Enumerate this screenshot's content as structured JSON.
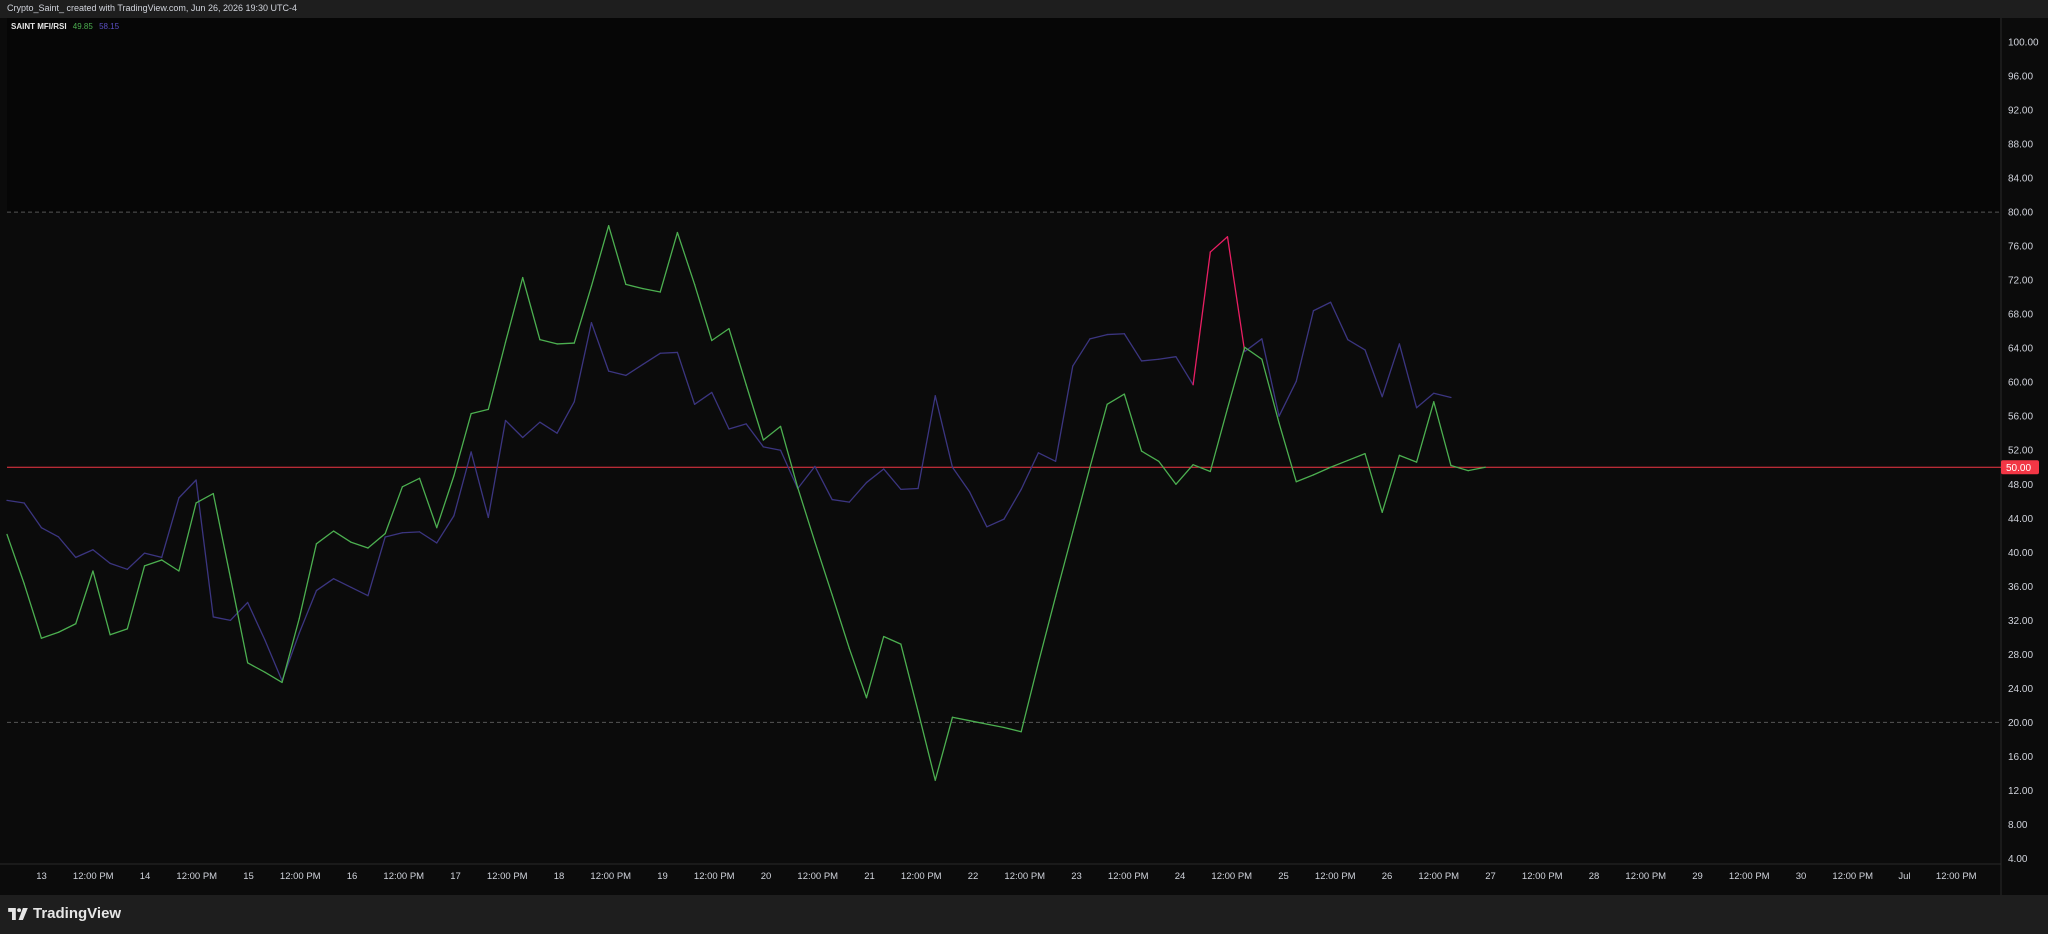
{
  "header": {
    "attribution": "Crypto_Saint_ created with TradingView.com, Jun 26, 2026 19:30 UTC-4"
  },
  "legend": {
    "indicator_name": "SAINT MFI/RSI",
    "mfi_value": "49.85",
    "rsi_value": "58.15"
  },
  "branding": {
    "logo_text": "TradingView",
    "logo_icon": "tradingview-logo-icon"
  },
  "colors": {
    "background": "#0b0b0b",
    "mfi_line": "#4caf50",
    "rsi_line": "#3b3580",
    "rsi_overbought": "#e91e63",
    "midline": "#f23645",
    "level_lines": "#555555"
  },
  "chart_data": {
    "type": "line",
    "title": "",
    "ylim": [
      2,
      104
    ],
    "y_ticks": [
      "100.00",
      "96.00",
      "92.00",
      "88.00",
      "84.00",
      "80.00",
      "76.00",
      "72.00",
      "68.00",
      "64.00",
      "60.00",
      "56.00",
      "52.00",
      "48.00",
      "44.00",
      "40.00",
      "36.00",
      "32.00",
      "28.00",
      "24.00",
      "20.00",
      "16.00",
      "12.00",
      "8.00",
      "4.00"
    ],
    "x_labels": [
      "13",
      "12:00 PM",
      "14",
      "12:00 PM",
      "15",
      "12:00 PM",
      "16",
      "12:00 PM",
      "17",
      "12:00 PM",
      "18",
      "12:00 PM",
      "19",
      "12:00 PM",
      "20",
      "12:00 PM",
      "21",
      "12:00 PM",
      "22",
      "12:00 PM",
      "23",
      "12:00 PM",
      "24",
      "12:00 PM",
      "25",
      "12:00 PM",
      "26",
      "12:00 PM",
      "27",
      "12:00 PM",
      "28",
      "12:00 PM",
      "29",
      "12:00 PM",
      "30",
      "12:00 PM",
      "Jul",
      "12:00 PM"
    ],
    "levels": [
      80,
      20
    ],
    "midline": {
      "value": 50,
      "label": "50.00"
    },
    "series": [
      {
        "values": [
          42.1,
          36.3,
          29.9,
          30.6,
          31.6,
          37.8,
          30.3,
          31.0,
          38.4,
          39.1,
          37.8,
          45.8,
          46.9,
          37.0,
          27.0,
          25.9,
          24.7,
          32.2,
          41.0,
          42.5,
          41.2,
          40.5,
          42.2,
          47.7,
          48.7,
          42.9,
          49.0,
          56.3,
          56.8,
          64.7,
          72.3,
          65.0,
          64.5,
          64.6,
          71.3,
          78.4,
          71.5,
          71.0,
          70.6,
          77.6,
          71.5,
          64.9,
          66.3,
          59.7,
          53.2,
          54.8,
          47.6,
          41.2,
          35.0,
          28.7,
          22.9,
          30.1,
          29.2,
          21.3,
          13.2,
          20.6,
          20.2,
          19.8,
          19.4,
          18.9,
          27.0,
          34.8,
          42.4,
          50.0,
          57.4,
          58.6,
          51.9,
          50.7,
          48.0,
          50.3,
          49.5,
          56.9,
          64.1,
          62.7,
          55.2,
          48.3,
          49.1,
          50.0,
          50.8,
          51.6,
          44.7,
          51.4,
          50.6,
          57.7,
          50.2,
          49.6,
          50.0
        ]
      },
      {
        "values": [
          46.1,
          45.8,
          42.9,
          41.8,
          39.4,
          40.3,
          38.7,
          38.0,
          39.9,
          39.4,
          46.4,
          48.5,
          32.4,
          32.0,
          34.1,
          29.7,
          24.9,
          30.5,
          35.5,
          36.9,
          35.9,
          34.9,
          41.8,
          42.3,
          42.4,
          41.1,
          44.3,
          51.8,
          44.1,
          55.5,
          53.5,
          55.3,
          54.0,
          57.7,
          67.0,
          61.3,
          60.8,
          62.1,
          63.4,
          63.5,
          57.4,
          58.8,
          54.5,
          55.1,
          52.4,
          52.0,
          47.5,
          50.1,
          46.2,
          45.9,
          48.2,
          49.8,
          47.4,
          47.5,
          58.4,
          50.0,
          47.1,
          43.0,
          43.9,
          47.4,
          51.7,
          50.7,
          61.9,
          65.1,
          65.6,
          65.7,
          62.5,
          62.7,
          63.0,
          59.7,
          75.3,
          77.1,
          63.6,
          65.1,
          56.0,
          60.1,
          68.4,
          69.4,
          65.0,
          63.8,
          58.3,
          64.5,
          57.0,
          58.7,
          58.2
        ]
      }
    ]
  }
}
